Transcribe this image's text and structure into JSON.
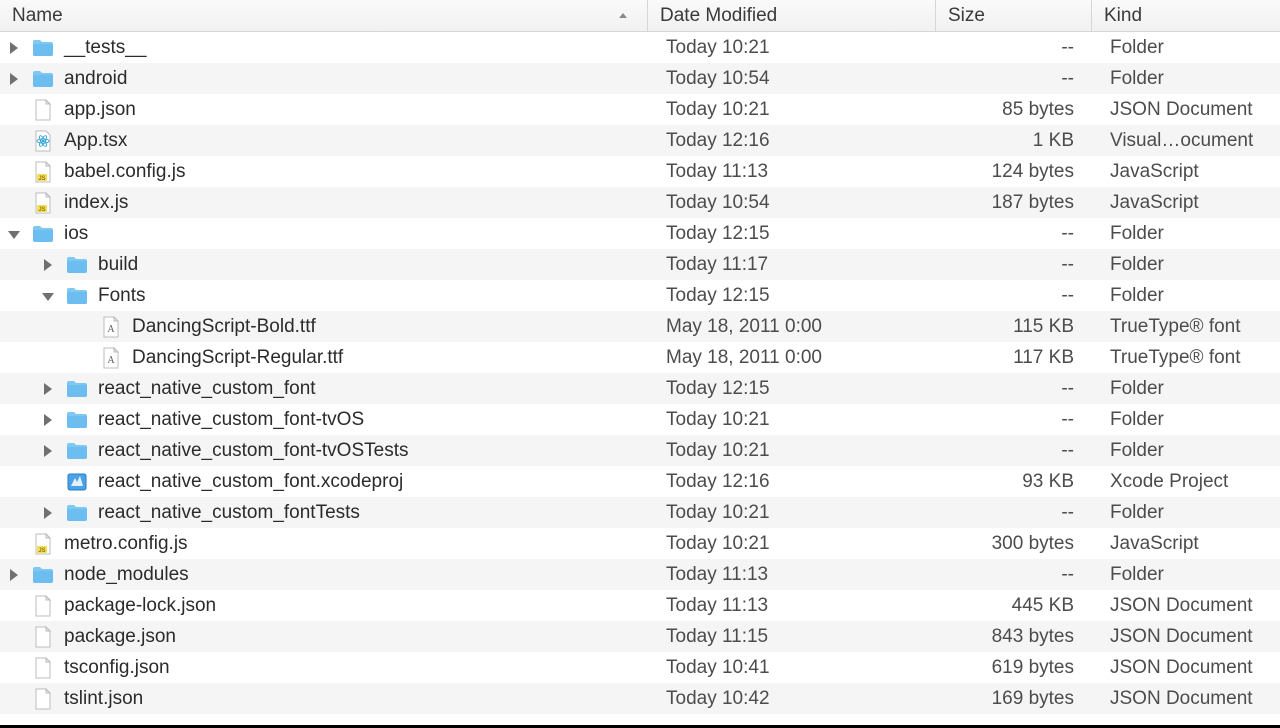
{
  "columns": {
    "name": "Name",
    "date": "Date Modified",
    "size": "Size",
    "kind": "Kind"
  },
  "icons": {
    "folder": "folder",
    "generic": "generic-file",
    "js": "js-file",
    "react": "react-file",
    "font": "font-file",
    "xcode": "xcode-project"
  },
  "rows": [
    {
      "depth": 0,
      "disclosure": "closed",
      "icon": "folder",
      "name": "__tests__",
      "date": "Today 10:21",
      "size": "--",
      "kind": "Folder"
    },
    {
      "depth": 0,
      "disclosure": "closed",
      "icon": "folder",
      "name": "android",
      "date": "Today 10:54",
      "size": "--",
      "kind": "Folder"
    },
    {
      "depth": 0,
      "disclosure": "none",
      "icon": "generic",
      "name": "app.json",
      "date": "Today 10:21",
      "size": "85 bytes",
      "kind": "JSON Document"
    },
    {
      "depth": 0,
      "disclosure": "none",
      "icon": "react",
      "name": "App.tsx",
      "date": "Today 12:16",
      "size": "1 KB",
      "kind": "Visual…ocument"
    },
    {
      "depth": 0,
      "disclosure": "none",
      "icon": "js",
      "name": "babel.config.js",
      "date": "Today 11:13",
      "size": "124 bytes",
      "kind": "JavaScript"
    },
    {
      "depth": 0,
      "disclosure": "none",
      "icon": "js",
      "name": "index.js",
      "date": "Today 10:54",
      "size": "187 bytes",
      "kind": "JavaScript"
    },
    {
      "depth": 0,
      "disclosure": "open",
      "icon": "folder",
      "name": "ios",
      "date": "Today 12:15",
      "size": "--",
      "kind": "Folder"
    },
    {
      "depth": 1,
      "disclosure": "closed",
      "icon": "folder",
      "name": "build",
      "date": "Today 11:17",
      "size": "--",
      "kind": "Folder"
    },
    {
      "depth": 1,
      "disclosure": "open",
      "icon": "folder",
      "name": "Fonts",
      "date": "Today 12:15",
      "size": "--",
      "kind": "Folder"
    },
    {
      "depth": 2,
      "disclosure": "none",
      "icon": "font",
      "name": "DancingScript-Bold.ttf",
      "date": "May 18, 2011 0:00",
      "size": "115 KB",
      "kind": "TrueType® font"
    },
    {
      "depth": 2,
      "disclosure": "none",
      "icon": "font",
      "name": "DancingScript-Regular.ttf",
      "date": "May 18, 2011 0:00",
      "size": "117 KB",
      "kind": "TrueType® font"
    },
    {
      "depth": 1,
      "disclosure": "closed",
      "icon": "folder",
      "name": "react_native_custom_font",
      "date": "Today 12:15",
      "size": "--",
      "kind": "Folder"
    },
    {
      "depth": 1,
      "disclosure": "closed",
      "icon": "folder",
      "name": "react_native_custom_font-tvOS",
      "date": "Today 10:21",
      "size": "--",
      "kind": "Folder"
    },
    {
      "depth": 1,
      "disclosure": "closed",
      "icon": "folder",
      "name": "react_native_custom_font-tvOSTests",
      "date": "Today 10:21",
      "size": "--",
      "kind": "Folder"
    },
    {
      "depth": 1,
      "disclosure": "none",
      "icon": "xcode",
      "name": "react_native_custom_font.xcodeproj",
      "date": "Today 12:16",
      "size": "93 KB",
      "kind": "Xcode Project"
    },
    {
      "depth": 1,
      "disclosure": "closed",
      "icon": "folder",
      "name": "react_native_custom_fontTests",
      "date": "Today 10:21",
      "size": "--",
      "kind": "Folder"
    },
    {
      "depth": 0,
      "disclosure": "none",
      "icon": "js",
      "name": "metro.config.js",
      "date": "Today 10:21",
      "size": "300 bytes",
      "kind": "JavaScript"
    },
    {
      "depth": 0,
      "disclosure": "closed",
      "icon": "folder",
      "name": "node_modules",
      "date": "Today 11:13",
      "size": "--",
      "kind": "Folder"
    },
    {
      "depth": 0,
      "disclosure": "none",
      "icon": "generic",
      "name": "package-lock.json",
      "date": "Today 11:13",
      "size": "445 KB",
      "kind": "JSON Document"
    },
    {
      "depth": 0,
      "disclosure": "none",
      "icon": "generic",
      "name": "package.json",
      "date": "Today 11:15",
      "size": "843 bytes",
      "kind": "JSON Document"
    },
    {
      "depth": 0,
      "disclosure": "none",
      "icon": "generic",
      "name": "tsconfig.json",
      "date": "Today 10:41",
      "size": "619 bytes",
      "kind": "JSON Document"
    },
    {
      "depth": 0,
      "disclosure": "none",
      "icon": "generic",
      "name": "tslint.json",
      "date": "Today 10:42",
      "size": "169 bytes",
      "kind": "JSON Document"
    }
  ]
}
